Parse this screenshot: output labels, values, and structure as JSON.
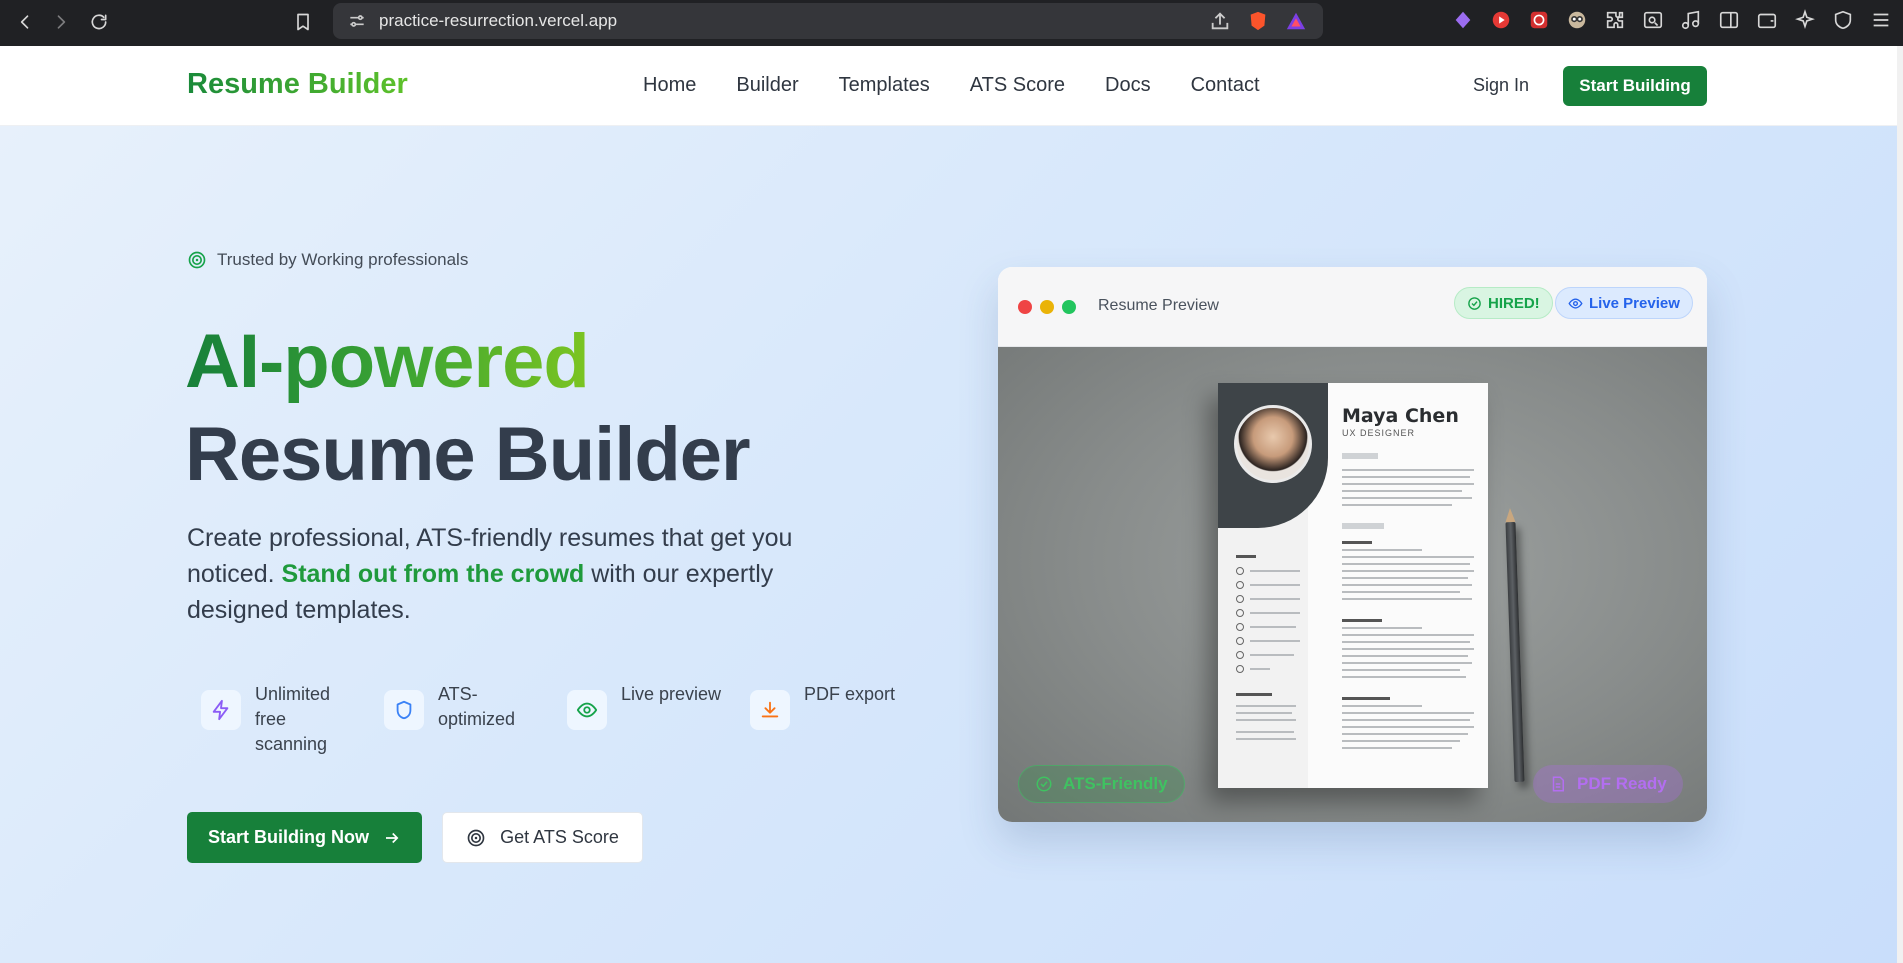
{
  "browser": {
    "url": "practice-resurrection.vercel.app"
  },
  "header": {
    "brand": "Resume Builder",
    "nav": [
      "Home",
      "Builder",
      "Templates",
      "ATS Score",
      "Docs",
      "Contact"
    ],
    "sign_in": "Sign In",
    "start_building": "Start Building"
  },
  "hero": {
    "trusted": "Trusted by Working professionals",
    "title_line1": "AI-powered",
    "title_line2": "Resume Builder",
    "lead_before": "Create professional, ATS-friendly resumes that get you noticed. ",
    "lead_highlight": "Stand out from the crowd",
    "lead_after": " with our expertly designed templates.",
    "features": [
      {
        "label": "Unlimited free scanning",
        "icon": "lightning-icon",
        "color": "#8b5cf6"
      },
      {
        "label": "ATS-optimized",
        "icon": "shield-icon",
        "color": "#3b82f6"
      },
      {
        "label": "Live preview",
        "icon": "eye-icon",
        "color": "#16a34a"
      },
      {
        "label": "PDF export",
        "icon": "download-icon",
        "color": "#f97316"
      }
    ],
    "cta_primary": "Start Building Now",
    "cta_secondary": "Get ATS Score"
  },
  "preview": {
    "title": "Resume Preview",
    "badge_hired": "HIRED!",
    "badge_live": "Live Preview",
    "resume_name": "Maya Chen",
    "resume_role": "UX DESIGNER",
    "badge_ats": "ATS-Friendly",
    "badge_pdf": "PDF Ready"
  },
  "colors": {
    "brand_green": "#17803a",
    "accent_light_green": "#7cc521",
    "text_dark": "#333d4c"
  }
}
